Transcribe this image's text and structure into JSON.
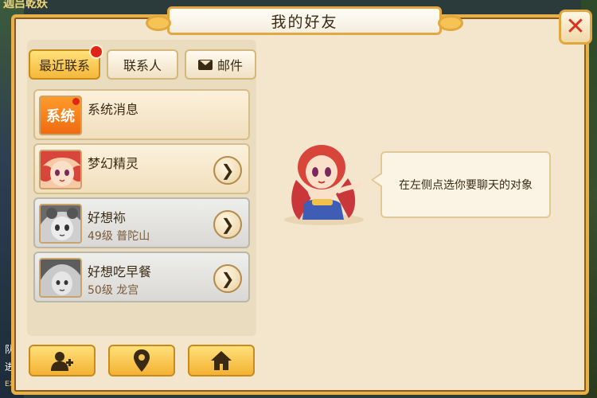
{
  "background": {
    "corner_text": "迦吕乾妖",
    "side_labels": [
      "队",
      "进",
      "EXP"
    ]
  },
  "window": {
    "title": "我的好友"
  },
  "tabs": [
    {
      "label": "最近联系",
      "active": true,
      "badge": true
    },
    {
      "label": "联系人",
      "active": false,
      "badge": false
    },
    {
      "label": "邮件",
      "active": false,
      "badge": false,
      "icon": "mail-icon"
    }
  ],
  "contacts": [
    {
      "avatar_text": "系统",
      "name": "系统消息",
      "sub": "",
      "has_arrow": false,
      "badge": true,
      "style": "gold"
    },
    {
      "avatar_text": "",
      "name": "梦幻精灵",
      "sub": "",
      "has_arrow": true,
      "badge": false,
      "style": "gold"
    },
    {
      "avatar_text": "",
      "name": "好想袮",
      "sub": "49级  普陀山",
      "has_arrow": true,
      "badge": false,
      "style": "grey"
    },
    {
      "avatar_text": "",
      "name": "好想吃早餐",
      "sub": "50级  龙宫",
      "has_arrow": true,
      "badge": false,
      "style": "grey"
    }
  ],
  "bottom_buttons": [
    {
      "icon": "add-friend-icon"
    },
    {
      "icon": "location-pin-icon"
    },
    {
      "icon": "home-icon"
    }
  ],
  "hint": {
    "text": "在左侧点选你要聊天的对象"
  },
  "colors": {
    "accent_gold": "#f5b83b",
    "frame_border": "#e7b049",
    "panel_bg": "#f3e6cc",
    "badge_red": "#e0241a",
    "close_red": "#d8321e"
  }
}
